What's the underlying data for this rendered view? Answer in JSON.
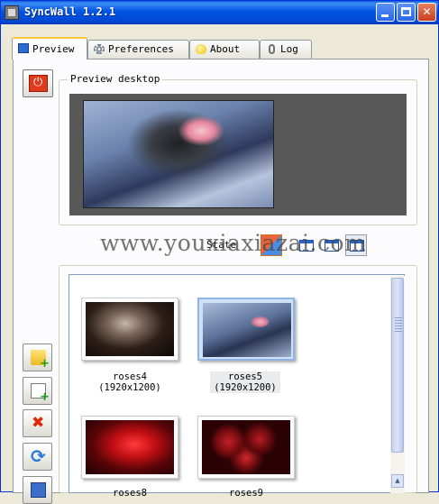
{
  "window": {
    "title": "SyncWall 1.2.1"
  },
  "tabs": [
    {
      "label": "Preview",
      "icon": "monitor-icon",
      "active": true
    },
    {
      "label": "Preferences",
      "icon": "gear-icon",
      "active": false
    },
    {
      "label": "About",
      "icon": "bulb-icon",
      "active": false
    },
    {
      "label": "Log",
      "icon": "paperclip-icon",
      "active": false
    }
  ],
  "preview": {
    "group_label": "Preview desktop",
    "state_label": "State"
  },
  "watermark": "www.youxiaxiazai.com",
  "wallpapers": [
    {
      "name": "roses4",
      "resolution": "(1920x1200)",
      "selected": false
    },
    {
      "name": "roses5",
      "resolution": "(1920x1200)",
      "selected": true
    },
    {
      "name": "roses8",
      "resolution": "",
      "selected": false
    },
    {
      "name": "roses9",
      "resolution": "",
      "selected": false
    }
  ],
  "side_buttons": [
    "add-folder",
    "add-file",
    "delete",
    "refresh",
    "export"
  ],
  "colors": {
    "title_bar": "#0055e5",
    "close_button": "#c8401e",
    "selection": "#cfe0f8"
  }
}
